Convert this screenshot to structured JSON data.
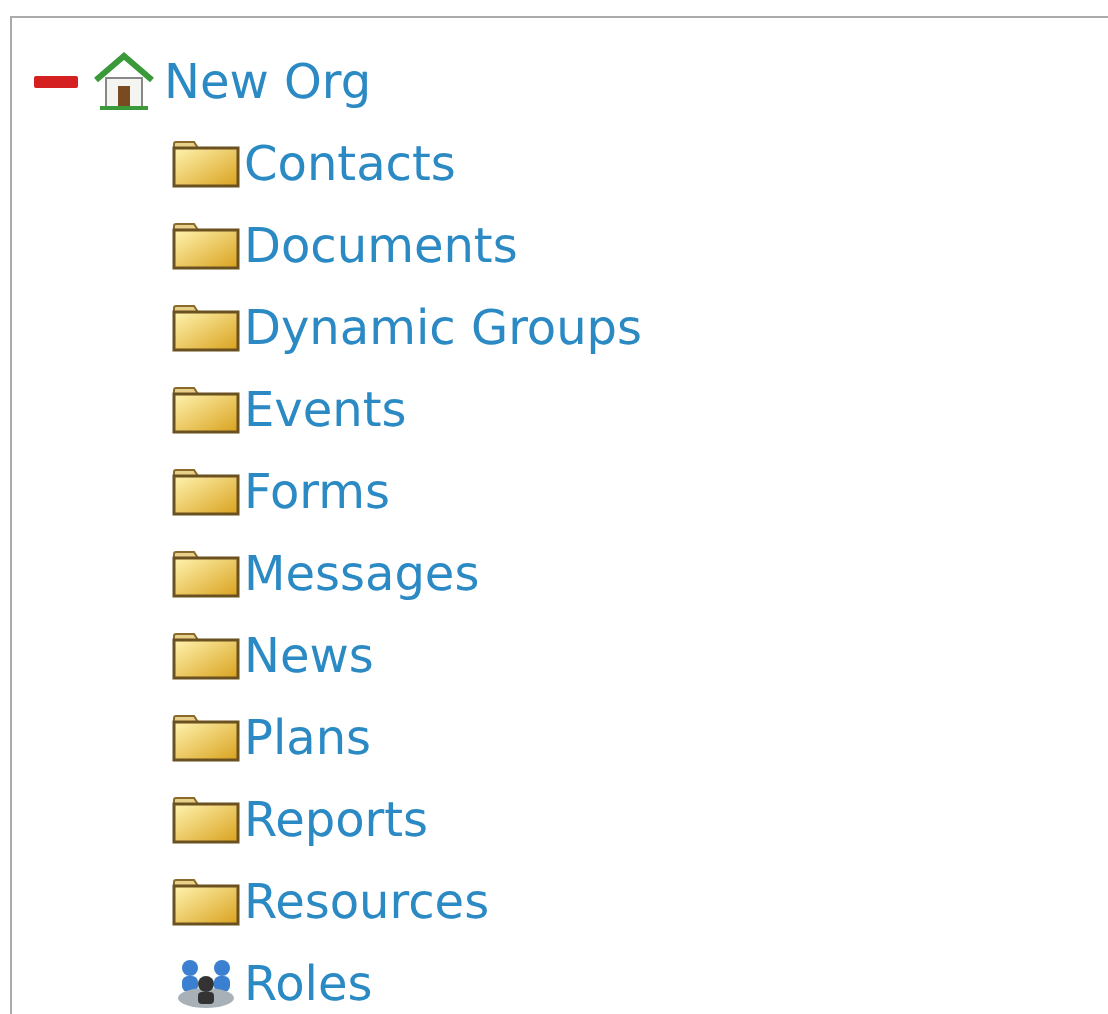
{
  "tree": [
    {
      "label": "New Org",
      "kind": "org",
      "expanded": true,
      "children": [
        {
          "label": "Contacts",
          "kind": "folder"
        },
        {
          "label": "Documents",
          "kind": "folder"
        },
        {
          "label": "Dynamic Groups",
          "kind": "folder"
        },
        {
          "label": "Events",
          "kind": "folder"
        },
        {
          "label": "Forms",
          "kind": "folder"
        },
        {
          "label": "Messages",
          "kind": "folder"
        },
        {
          "label": "News",
          "kind": "folder"
        },
        {
          "label": "Plans",
          "kind": "folder"
        },
        {
          "label": "Reports",
          "kind": "folder"
        },
        {
          "label": "Resources",
          "kind": "folder"
        },
        {
          "label": "Roles",
          "kind": "roles"
        }
      ]
    }
  ]
}
